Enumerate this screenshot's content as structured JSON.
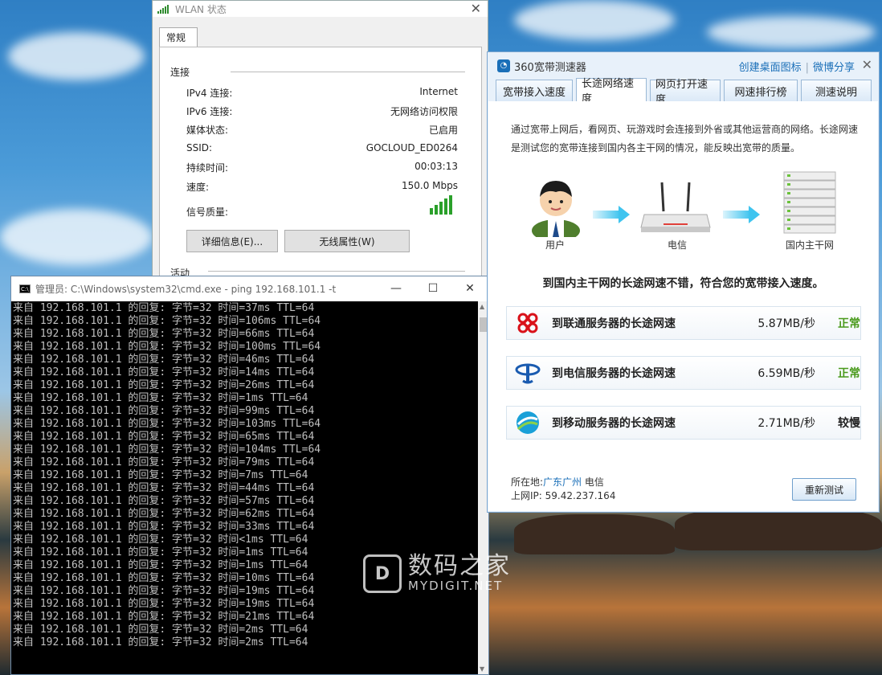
{
  "wlan": {
    "title": "WLAN 状态",
    "tab": "常规",
    "section_connection": "连接",
    "section_activity": "活动",
    "rows": [
      {
        "label": "IPv4 连接:",
        "value": "Internet"
      },
      {
        "label": "IPv6 连接:",
        "value": "无网络访问权限"
      },
      {
        "label": "媒体状态:",
        "value": "已启用"
      },
      {
        "label": "SSID:",
        "value": "GOCLOUD_ED0264"
      },
      {
        "label": "持续时间:",
        "value": "00:03:13"
      },
      {
        "label": "速度:",
        "value": "150.0 Mbps"
      },
      {
        "label": "信号质量:",
        "value": ""
      }
    ],
    "signal_bars": 5,
    "details_button": "详细信息(E)...",
    "wireless_button": "无线属性(W)"
  },
  "cmd": {
    "title": "管理员: C:\\Windows\\system32\\cmd.exe - ping  192.168.101.1 -t",
    "lines": [
      "来自 192.168.101.1 的回复: 字节=32 时间=37ms TTL=64",
      "来自 192.168.101.1 的回复: 字节=32 时间=106ms TTL=64",
      "来自 192.168.101.1 的回复: 字节=32 时间=66ms TTL=64",
      "来自 192.168.101.1 的回复: 字节=32 时间=100ms TTL=64",
      "来自 192.168.101.1 的回复: 字节=32 时间=46ms TTL=64",
      "来自 192.168.101.1 的回复: 字节=32 时间=14ms TTL=64",
      "来自 192.168.101.1 的回复: 字节=32 时间=26ms TTL=64",
      "来自 192.168.101.1 的回复: 字节=32 时间=1ms TTL=64",
      "来自 192.168.101.1 的回复: 字节=32 时间=99ms TTL=64",
      "来自 192.168.101.1 的回复: 字节=32 时间=103ms TTL=64",
      "来自 192.168.101.1 的回复: 字节=32 时间=65ms TTL=64",
      "来自 192.168.101.1 的回复: 字节=32 时间=104ms TTL=64",
      "来自 192.168.101.1 的回复: 字节=32 时间=79ms TTL=64",
      "来自 192.168.101.1 的回复: 字节=32 时间=7ms TTL=64",
      "来自 192.168.101.1 的回复: 字节=32 时间=44ms TTL=64",
      "来自 192.168.101.1 的回复: 字节=32 时间=57ms TTL=64",
      "来自 192.168.101.1 的回复: 字节=32 时间=62ms TTL=64",
      "来自 192.168.101.1 的回复: 字节=32 时间=33ms TTL=64",
      "来自 192.168.101.1 的回复: 字节=32 时间<1ms TTL=64",
      "来自 192.168.101.1 的回复: 字节=32 时间=1ms TTL=64",
      "来自 192.168.101.1 的回复: 字节=32 时间=1ms TTL=64",
      "来自 192.168.101.1 的回复: 字节=32 时间=10ms TTL=64",
      "来自 192.168.101.1 的回复: 字节=32 时间=19ms TTL=64",
      "来自 192.168.101.1 的回复: 字节=32 时间=19ms TTL=64",
      "来自 192.168.101.1 的回复: 字节=32 时间=21ms TTL=64",
      "来自 192.168.101.1 的回复: 字节=32 时间=2ms TTL=64",
      "来自 192.168.101.1 的回复: 字节=32 时间=2ms TTL=64"
    ]
  },
  "speedtest": {
    "title": "360宽带测速器",
    "link_shortcut": "创建桌面图标",
    "link_weibo": "微博分享",
    "tabs": [
      "宽带接入速度",
      "长途网络速度",
      "网页打开速度",
      "网速排行榜",
      "测速说明"
    ],
    "active_tab": 1,
    "intro": "通过宽带上网后，看网页、玩游戏时会连接到外省或其他运营商的网络。长途网速是测试您的宽带连接到国内各主干网的情况，能反映出宽带的质量。",
    "diagram": {
      "user": "用户",
      "isp": "电信",
      "backbone": "国内主干网"
    },
    "summary": "到国内主干网的长途网速不错，符合您的宽带接入速度。",
    "results": [
      {
        "name": "到联通服务器的长途网速",
        "value": "5.87MB/秒",
        "status": "正常",
        "status_color": "#4a9a1c",
        "logo": "unicom-logo"
      },
      {
        "name": "到电信服务器的长途网速",
        "value": "6.59MB/秒",
        "status": "正常",
        "status_color": "#4a9a1c",
        "logo": "telecom-logo"
      },
      {
        "name": "到移动服务器的长途网速",
        "value": "2.71MB/秒",
        "status": "较慢",
        "status_color": "#222222",
        "logo": "mobile-logo"
      }
    ],
    "location_label": "所在地:",
    "location_value": "广东广州",
    "location_isp": "电信",
    "ip_label": "上网IP:",
    "ip_value": "59.42.237.164",
    "retest_button": "重新测试"
  },
  "watermark": {
    "line1": "数码之家",
    "line2": "MYDIGIT.NET"
  }
}
